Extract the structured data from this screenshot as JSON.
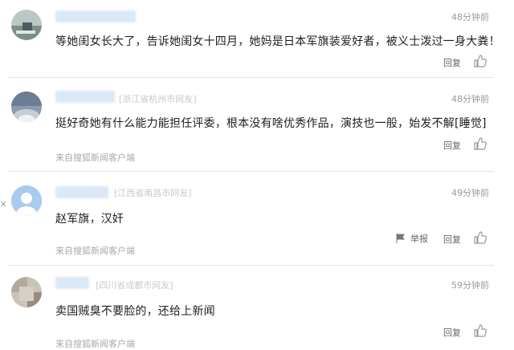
{
  "comments": [
    {
      "location": "",
      "time": "48分钟前",
      "content": "等她闺女长大了，告诉她闺女十四月，她妈是日本军旗装爱好者，被义士泼过一身大粪！",
      "source": "",
      "reply_label": "回复",
      "report_label": "",
      "avatar_icon": "avatar-landscape-icon",
      "colors": {
        "avatar_bg": "#8fa6a6"
      }
    },
    {
      "location": "[浙江省杭州市网友]",
      "time": "48分钟前",
      "content": "挺好奇她有什么能力能担任评委，根本没有啥优秀作品，演技也一般，始发不解[睡觉]",
      "source": "来自搜狐新闻客户端",
      "reply_label": "回复",
      "report_label": "",
      "avatar_icon": "avatar-sunset-icon"
    },
    {
      "location": "[江西省南昌市网友]",
      "time": "49分钟前",
      "content": "赵军旗，汉奸",
      "source": "来自搜狐新闻客户端",
      "reply_label": "回复",
      "report_label": "举报",
      "avatar_icon": "avatar-default-person-icon"
    },
    {
      "location": "[四川省成都市网友]",
      "time": "59分钟前",
      "content": "卖国贼臭不要脸的，还给上新闻",
      "source": "来自搜狐新闻客户端",
      "reply_label": "回复",
      "report_label": "",
      "avatar_icon": "avatar-blurred-photo-icon"
    }
  ],
  "side_close": "×",
  "colors": {
    "username_blur": "#dbe8f6",
    "location_text": "#c9c9c9",
    "divider": "#e4e4e4",
    "default_avatar_bg": "#9ec3ea"
  }
}
